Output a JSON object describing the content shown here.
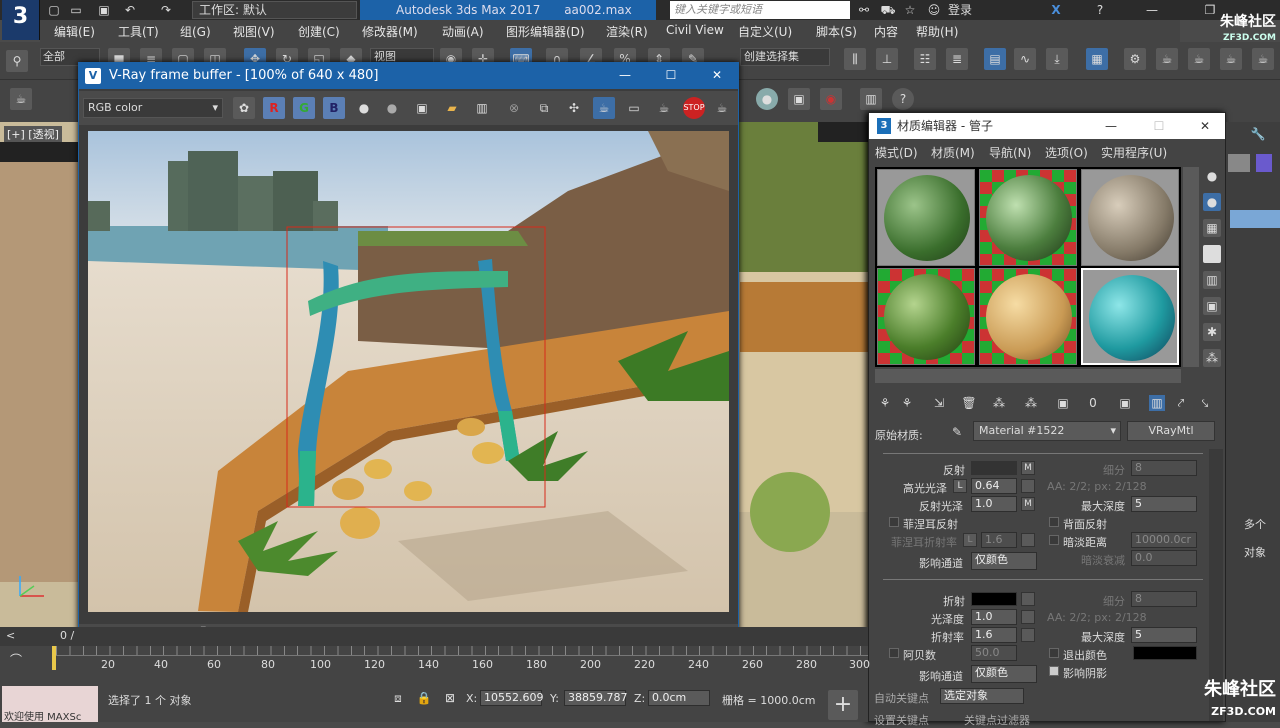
{
  "app": {
    "logo": "3",
    "title": "Autodesk 3ds Max 2017",
    "file": "aa002.max",
    "workspace": "工作区: 默认",
    "search_placeholder": "键入关键字或短语",
    "login": "登录",
    "brand": "朱峰社区",
    "brand_url": "ZF3D.COM"
  },
  "menu": [
    "编辑(E)",
    "工具(T)",
    "组(G)",
    "视图(V)",
    "创建(C)",
    "修改器(M)",
    "动画(A)",
    "图形编辑器(D)",
    "渲染(R)",
    "Civil View",
    "自定义(U)",
    "脚本(S)",
    "内容",
    "帮助(H)"
  ],
  "toolbar": {
    "selection_filter": "全部",
    "view_mode": "视图",
    "selection_set": "创建选择集"
  },
  "viewport": {
    "label": "[+] [透视]"
  },
  "vfb": {
    "title": "V-Ray frame buffer - [100% of 640 x 480]",
    "channel": "RGB color",
    "r": "R",
    "g": "G",
    "b": "B"
  },
  "material_editor": {
    "title": "材质编辑器 - 管子",
    "menu": [
      "模式(D)",
      "材质(M)",
      "导航(N)",
      "选项(O)",
      "实用程序(U)"
    ],
    "base_material_label": "原始材质:",
    "material_name": "Material #1522",
    "material_type": "VRayMtl",
    "reflection": {
      "label": "反射",
      "m": "M",
      "subdivs_label": "细分",
      "subdivs": "8",
      "hilight_gloss_label": "高光光泽",
      "lock": "L",
      "hilight_gloss": "0.64",
      "aa_info": "AA: 2/2; px: 2/128",
      "refl_gloss_label": "反射光泽",
      "refl_gloss": "1.0",
      "max_depth_label": "最大深度",
      "max_depth": "5",
      "fresnel_label": "菲涅耳反射",
      "backside_label": "背面反射",
      "fresnel_ior_label": "菲涅耳折射率",
      "fresnel_ior": "1.6",
      "dim_distance_label": "暗淡距离",
      "dim_distance": "10000.0cr",
      "dim_falloff_label": "暗淡衰减",
      "dim_falloff": "0.0",
      "affect_channels_label": "影响通道",
      "affect_channels": "仅颜色"
    },
    "refraction": {
      "label": "折射",
      "subdivs_label": "细分",
      "subdivs": "8",
      "gloss_label": "光泽度",
      "gloss": "1.0",
      "aa_info": "AA: 2/2; px: 2/128",
      "ior_label": "折射率",
      "ior": "1.6",
      "max_depth_label": "最大深度",
      "max_depth": "5",
      "abbe_label": "阿贝数",
      "abbe": "50.0",
      "exit_color_label": "退出颜色",
      "affect_channels_label": "影响通道",
      "affect_channels": "仅颜色",
      "affect_shadows_label": "影响阴影"
    }
  },
  "command_panel": {
    "multiple": "多个",
    "object": "对象"
  },
  "timeline": {
    "frame_display": "0 /",
    "ticks": [
      "20",
      "40",
      "60",
      "80",
      "100",
      "120",
      "140",
      "160",
      "180",
      "200",
      "220",
      "240",
      "260",
      "280",
      "300"
    ]
  },
  "status": {
    "listener": "欢迎使用 MAXSc",
    "message": "选择了 1 个 对象",
    "x_label": "X:",
    "x": "10552.609",
    "y_label": "Y:",
    "y": "38859.787",
    "z_label": "Z:",
    "z": "0.0cm",
    "grid": "栅格 = 1000.0cm",
    "auto_key": "自动关键点",
    "selected": "选定对象",
    "set_key": "设置关键点",
    "key_filters": "关键点过滤器"
  }
}
